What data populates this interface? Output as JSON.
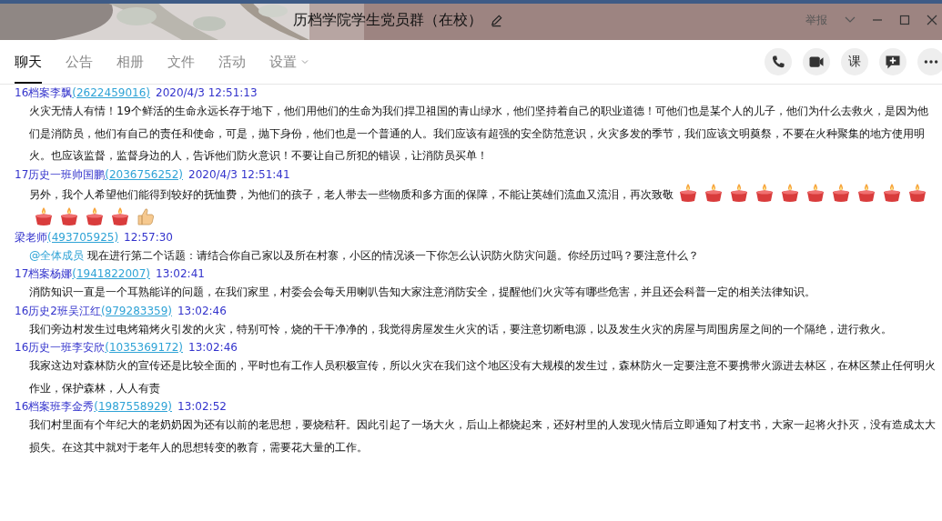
{
  "window": {
    "title": "历档学院学生党员群（在校）",
    "report": "举报"
  },
  "tabs": [
    {
      "label": "聊天",
      "selected": true,
      "dropdown": false
    },
    {
      "label": "公告",
      "selected": false,
      "dropdown": false
    },
    {
      "label": "相册",
      "selected": false,
      "dropdown": false
    },
    {
      "label": "文件",
      "selected": false,
      "dropdown": false
    },
    {
      "label": "活动",
      "selected": false,
      "dropdown": false
    },
    {
      "label": "设置",
      "selected": false,
      "dropdown": true
    }
  ],
  "tools": [
    {
      "kind": "phone"
    },
    {
      "kind": "video"
    },
    {
      "kind": "text",
      "label": "课"
    },
    {
      "kind": "add-message"
    },
    {
      "kind": "more"
    }
  ],
  "messages": [
    {
      "sender": "16档案李飘",
      "qq": "(2622459016)",
      "time": "2020/4/3 12:51:13",
      "text": "火灾无情人有情！19个鲜活的生命永远长存于地下，他们用他们的生命为我们捍卫祖国的青山绿水，他们坚持着自己的职业道德！可他们也是某个人的儿子，他们为什么去救火，是因为他们是消防员，他们有自己的责任和使命，可是，抛下身份，他们也是一个普通的人。我们应该有超强的安全防范意识，火灾多发的季节，我们应该文明奠祭，不要在火种聚集的地方使用明火。也应该监督，监督身边的人，告诉他们防火意识！不要让自己所犯的错误，让消防员买单！"
    },
    {
      "sender": "17历史一班帅国鹏",
      "qq": "(2036756252)",
      "time": "2020/4/3 12:51:41",
      "text": "另外，我个人希望他们能得到较好的抚恤费，为他们的孩子，老人带去一些物质和多方面的保障，不能让英雄们流血又流泪，再次致敬",
      "emojis": [
        {
          "kind": "candle"
        },
        {
          "kind": "candle"
        },
        {
          "kind": "candle"
        },
        {
          "kind": "candle"
        },
        {
          "kind": "candle"
        },
        {
          "kind": "candle"
        },
        {
          "kind": "candle"
        },
        {
          "kind": "candle"
        },
        {
          "kind": "candle"
        },
        {
          "kind": "candle"
        },
        {
          "kind": "candle"
        },
        {
          "kind": "candle"
        },
        {
          "kind": "candle"
        },
        {
          "kind": "candle"
        },
        {
          "kind": "thumbs-up"
        }
      ]
    },
    {
      "sender": "梁老师",
      "qq": "(493705925)",
      "time": "12:57:30",
      "mention": "@全体成员",
      "text": "现在进行第二个话题：请结合你自己家以及所在村寨，小区的情况谈一下你怎么认识防火防灾问题。你经历过吗？要注意什么？"
    },
    {
      "sender": "17档案杨娜",
      "qq": "(1941822007)",
      "time": "13:02:41",
      "text": "消防知识一直是一个耳熟能详的问题，在我们家里，村委会会每天用喇叭告知大家注意消防安全，提醒他们火灾等有哪些危害，并且还会科普一定的相关法律知识。"
    },
    {
      "sender": "16历史2班吴江红",
      "qq": "(979283359)",
      "time": "13:02:46",
      "text": "我们旁边村发生过电烤箱烤火引发的火灾，特别可怜，烧的干干净净的，我觉得房屋发生火灾的话，要注意切断电源，以及发生火灾的房屋与周围房屋之间的一个隔绝，进行救火。"
    },
    {
      "sender": "16历史一班李安欣",
      "qq": "(1035369172)",
      "time": "13:02:46",
      "text": "我家这边对森林防火的宣传还是比较全面的，平时也有工作人员积极宣传，所以火灾在我们这个地区没有大规模的发生过，森林防火一定要注意不要携带火源进去林区，在林区禁止任何明火作业，保护森林，人人有责"
    },
    {
      "sender": "16档案班李金秀",
      "qq": "(1987558929)",
      "time": "13:02:52",
      "text": "我们村里面有个年纪大的老奶奶因为还有以前的老思想，要烧秸秆。因此引起了一场大火，后山上都烧起来，还好村里的人发现火情后立即通知了村支书，大家一起将火扑灭，没有造成太大损失。在这其中就对于老年人的思想转变的教育，需要花大量的工作。"
    }
  ]
}
